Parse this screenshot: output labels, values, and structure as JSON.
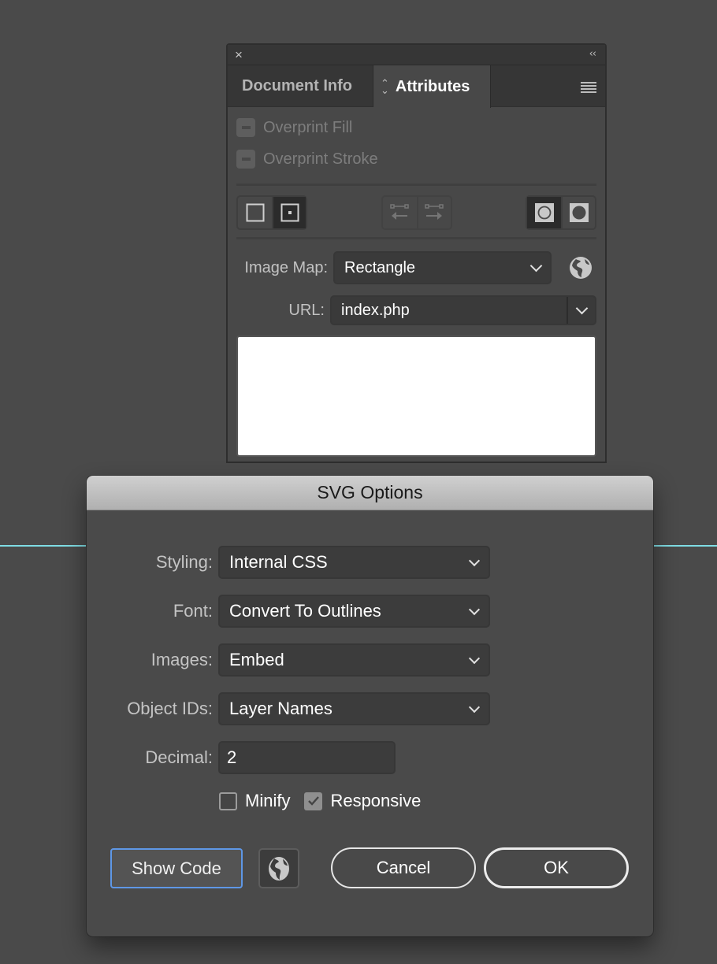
{
  "canvas": {
    "guide_color": "#7fdde4"
  },
  "panel": {
    "close_icon": "×",
    "collapse_icon": "‹‹",
    "tabs": [
      {
        "label": "Document Info",
        "active": false
      },
      {
        "label": "Attributes",
        "active": true
      }
    ],
    "menu_icon": "hamburger-icon",
    "overprint_fill": {
      "label": "Overprint Fill",
      "state": "mixed",
      "enabled": false
    },
    "overprint_stroke": {
      "label": "Overprint Stroke",
      "state": "mixed",
      "enabled": false
    },
    "center_buttons": {
      "dont_show_center": false,
      "show_center": true
    },
    "direction_buttons": {
      "reverse_path_direction_off": false,
      "reverse_path_direction_on": false,
      "enabled": false
    },
    "fill_rule_buttons": {
      "nonzero_winding": true,
      "even_odd": false
    },
    "image_map": {
      "label": "Image Map:",
      "value": "Rectangle"
    },
    "url": {
      "label": "URL:",
      "value": "index.php"
    },
    "notes": ""
  },
  "dialog": {
    "title": "SVG Options",
    "styling": {
      "label": "Styling:",
      "value": "Internal CSS"
    },
    "font": {
      "label": "Font:",
      "value": "Convert To Outlines"
    },
    "images": {
      "label": "Images:",
      "value": "Embed"
    },
    "object_ids": {
      "label": "Object IDs:",
      "value": "Layer Names"
    },
    "decimal": {
      "label": "Decimal:",
      "value": "2"
    },
    "minify": {
      "label": "Minify",
      "checked": false
    },
    "responsive": {
      "label": "Responsive",
      "checked": true
    },
    "show_code_label": "Show Code",
    "cancel_label": "Cancel",
    "ok_label": "OK",
    "accent_color": "#5e97e6"
  }
}
